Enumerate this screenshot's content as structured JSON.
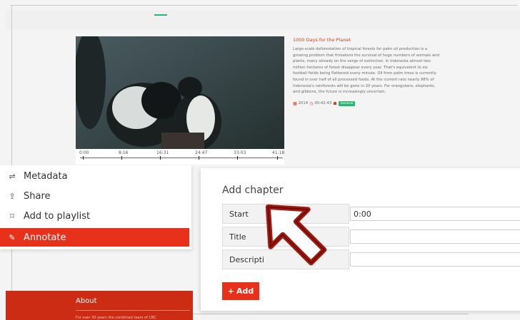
{
  "video": {
    "timeline_labels": [
      "0:00",
      "8:16",
      "16:31",
      "24:47",
      "33:03",
      "41:18"
    ]
  },
  "info": {
    "title": "1000 Days for the Planet",
    "description": "Large-scale deforestation of tropical forests for palm oil production is a growing problem that threatens the survival of huge numbers of animals and plants, many already on the verge of extinction. In Indonesia almost two million hectares of forest disappear every year. That's equivalent to six football fields being flattened every minute. Oil from palm trees is currently found in over half of all processed foods. At the current rate nearly 98% of Indonesia's rainforests will be gone in 20 years. For orangutans, elephants, and gibbons, the future is increasingly uncertain.",
    "year": "2014",
    "duration": "00:42:43",
    "category": "General"
  },
  "menu": {
    "items": [
      {
        "label": "Metadata",
        "icon": "sliders-icon"
      },
      {
        "label": "Share",
        "icon": "share-icon"
      },
      {
        "label": "Add to playlist",
        "icon": "bookmark-icon"
      },
      {
        "label": "Annotate",
        "icon": "pencil-icon"
      }
    ],
    "active_index": 3
  },
  "about": {
    "label": "About",
    "sub": "For over 30 years the combined team of CBC"
  },
  "chapter_form": {
    "title": "Add chapter",
    "start_label": "Start",
    "start_value": "0:00",
    "title_label": "Title",
    "description_label": "Descripti",
    "add_label": "Add",
    "add_icon": "+"
  },
  "colors": {
    "accent": "#e8311a",
    "green": "#2bb673"
  }
}
